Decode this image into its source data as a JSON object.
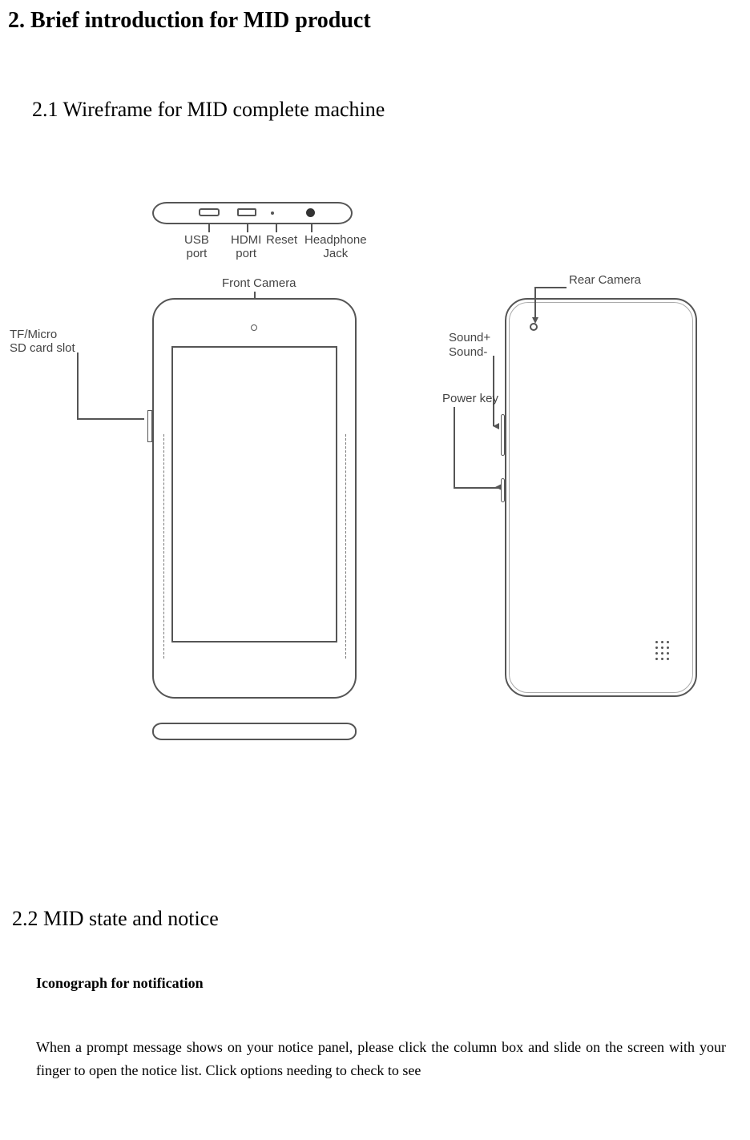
{
  "section": {
    "heading": "2. Brief introduction for MID product",
    "sub21": "2.1 Wireframe for MID complete machine",
    "sub22": "2.2 MID state and notice",
    "iconograph": "Iconograph for notification",
    "paragraph": "When a prompt message shows on your notice panel, please click the column box and slide on the screen with your finger to open the notice list. Click options needing to check to see"
  },
  "diagram": {
    "usb": "USB\nport",
    "hdmi": "HDMI\nport",
    "reset": "Reset",
    "headphone": "Headphone\nJack",
    "front_camera": "Front Camera",
    "sd_slot": "TF/Micro\nSD card slot",
    "rear_camera": "Rear Camera",
    "sound_plus": "Sound+",
    "sound_minus": "Sound-",
    "power_key": "Power key"
  }
}
